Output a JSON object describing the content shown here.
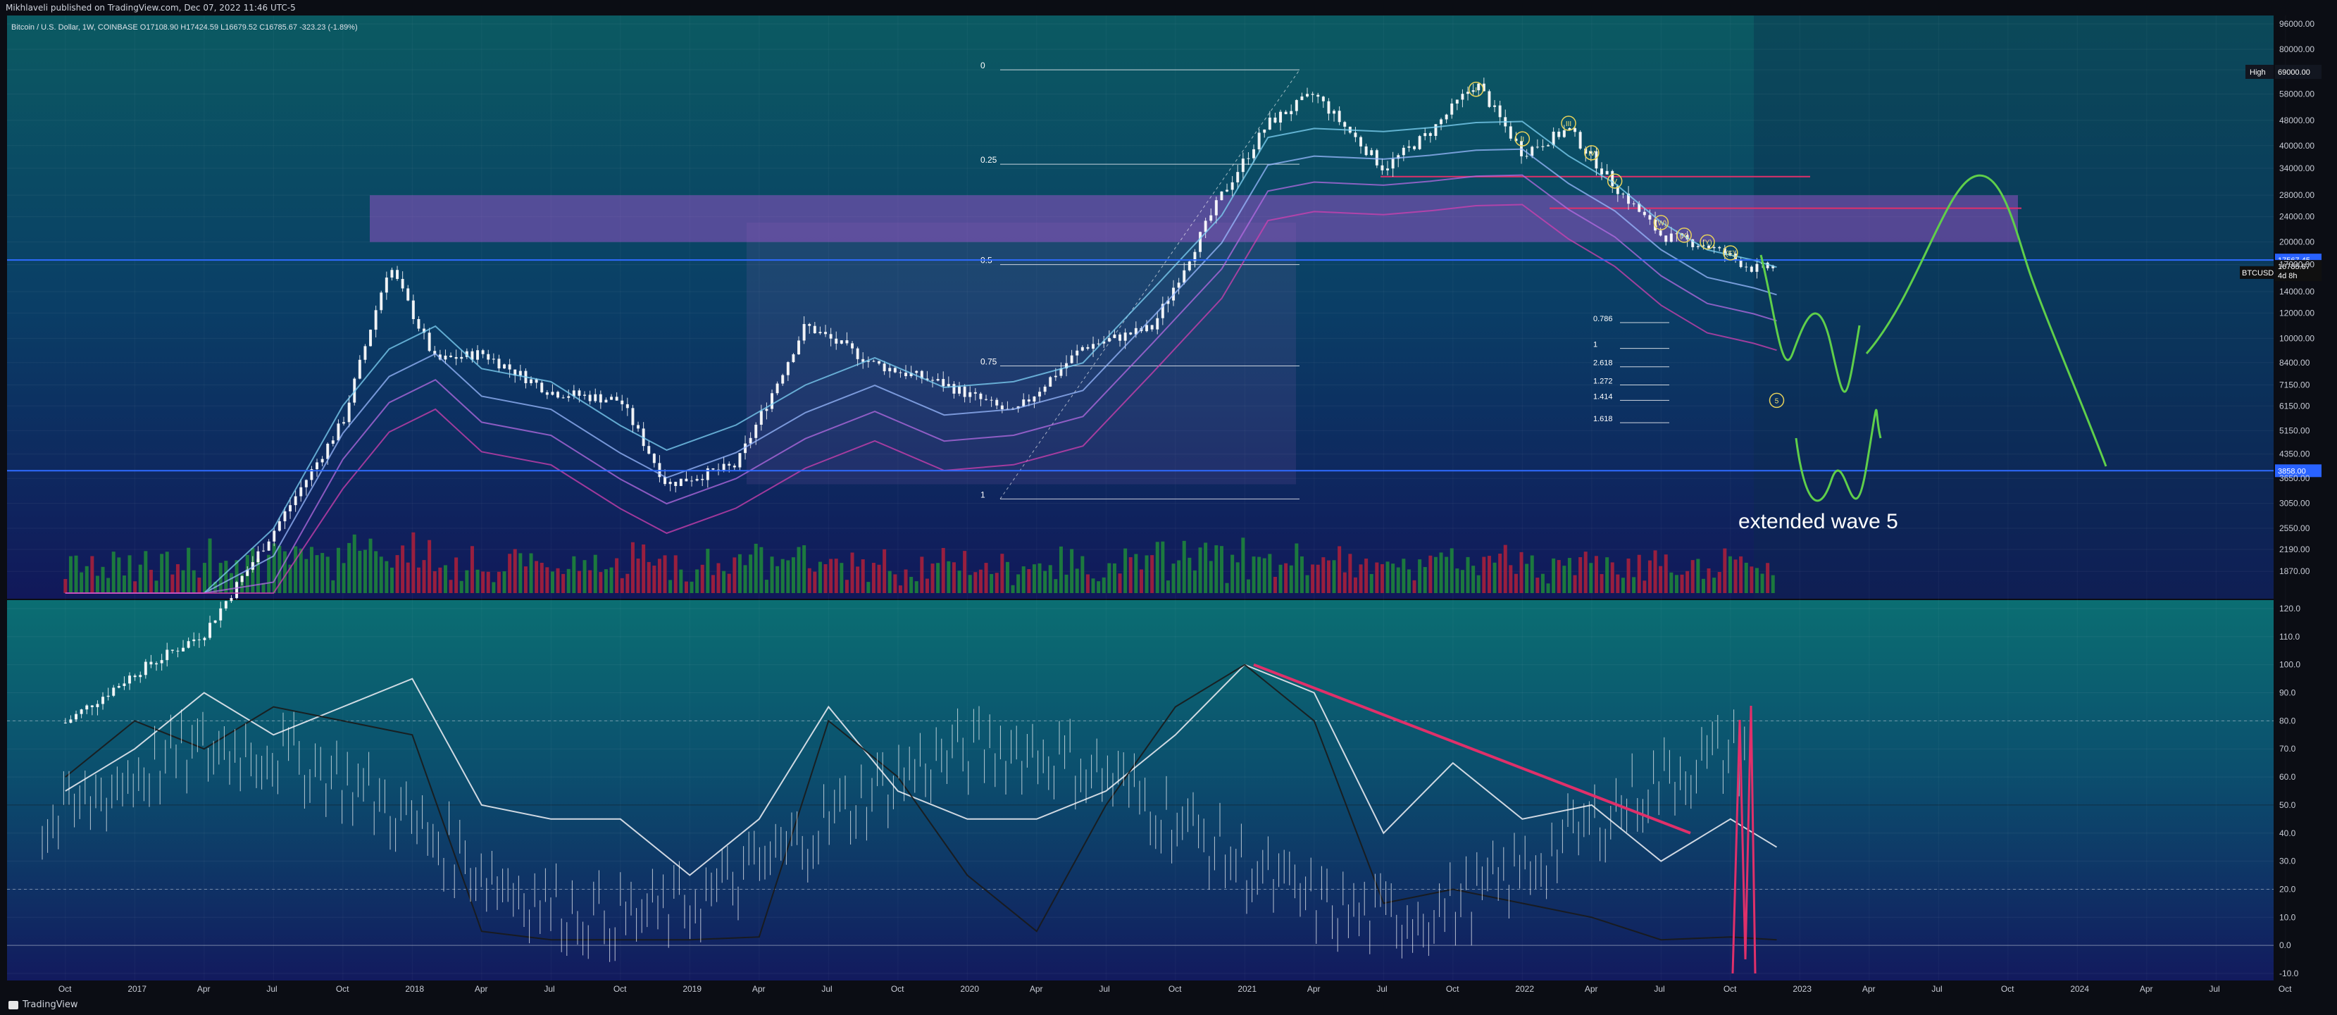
{
  "header": {
    "publisher": "Mikhlaveli published on TradingView.com, Dec 07, 2022 11:46 UTC-5"
  },
  "footer": {
    "brand": "TradingView"
  },
  "chart_data": [
    {
      "type": "candlestick",
      "symbol_line": "Bitcoin / U.S. Dollar, 1W, COINBASE O17108.90 H17424.59 L16679.52 C16785.67 -323.23 (-1.89%)",
      "ticker": "BTCUSD",
      "log_scale": true,
      "grid": true,
      "ylim": [
        1600,
        96000
      ],
      "price_axis_ticks": [
        96000,
        80000,
        69000,
        58000,
        48000,
        40000,
        34000,
        28000,
        24000,
        20000,
        17000,
        14000,
        12000,
        10000,
        8400,
        7150,
        6150,
        5150,
        4350,
        3650,
        3050,
        2550,
        2190,
        1870
      ],
      "price_axis_labels": [
        "96000.00",
        "80000.00",
        "69000.00",
        "58000.00",
        "48000.00",
        "40000.00",
        "34000.00",
        "28000.00",
        "24000.00",
        "20000.00",
        "17000.00",
        "14000.00",
        "12000.00",
        "10000.00",
        "8400.00",
        "7150.00",
        "6150.00",
        "5150.00",
        "4350.00",
        "3650.00",
        "3050.00",
        "2550.00",
        "2190.00",
        "1870.00"
      ],
      "time_axis_labels": [
        "Oct",
        "2017",
        "Apr",
        "Jul",
        "Oct",
        "2018",
        "Apr",
        "Jul",
        "Oct",
        "2019",
        "Apr",
        "Jul",
        "Oct",
        "2020",
        "Apr",
        "Jul",
        "Oct",
        "2021",
        "Apr",
        "Jul",
        "Oct",
        "2022",
        "Apr",
        "Jul",
        "Oct",
        "2023",
        "Apr",
        "Jul",
        "Oct",
        "2024",
        "Apr",
        "Jul",
        "Oct"
      ],
      "high_label": "High",
      "high_value": "69000.00",
      "markers": [
        {
          "price": 17567.45,
          "label": "17567.45",
          "color": "#2962ff"
        },
        {
          "price": 16785.67,
          "label": "16785.67",
          "sub": "4d 8h",
          "color": "#101010"
        },
        {
          "price": 3858.0,
          "label": "3858.00",
          "color": "#2962ff"
        }
      ],
      "close_price": 16785.67,
      "fib_retracement": {
        "levels": [
          "0",
          "0.25",
          "0.5",
          "0.75",
          "1"
        ],
        "prices": [
          69000,
          35000,
          17000,
          8200,
          3150
        ]
      },
      "fib_extension_labels": [
        "0.786",
        "1",
        "2.618",
        "1.272",
        "1.414",
        "1.618"
      ],
      "extension_prices": [
        11200,
        9300,
        8150,
        7150,
        6400,
        5450
      ],
      "wave_labels": [
        "I",
        "II",
        "III",
        "IV",
        "V",
        "(W)",
        "(X)",
        "(Y)",
        "(E)",
        "5"
      ],
      "annotation": "extended wave 5",
      "series": [
        {
          "name": "BTCUSD weekly close",
          "x": [
            "2016-10",
            "2017-01",
            "2017-04",
            "2017-07",
            "2017-10",
            "2017-12",
            "2018-02",
            "2018-04",
            "2018-07",
            "2018-10",
            "2018-12",
            "2019-03",
            "2019-06",
            "2019-09",
            "2019-12",
            "2020-03",
            "2020-06",
            "2020-09",
            "2020-12",
            "2021-02",
            "2021-04",
            "2021-07",
            "2021-09",
            "2021-11",
            "2022-01",
            "2022-03",
            "2022-05",
            "2022-07",
            "2022-09",
            "2022-11",
            "2022-12"
          ],
          "values": [
            630,
            900,
            1200,
            2500,
            5500,
            17000,
            8500,
            9000,
            6800,
            6400,
            3500,
            4000,
            11000,
            8300,
            7200,
            5800,
            9400,
            10800,
            28000,
            47000,
            58000,
            34000,
            44000,
            63000,
            38000,
            45000,
            30000,
            21000,
            19500,
            16500,
            16785.67
          ]
        }
      ]
    },
    {
      "type": "line",
      "name": "Oscillator",
      "ylim": [
        -10,
        120
      ],
      "axis_ticks": [
        120,
        110,
        100,
        90,
        80,
        70,
        60,
        50,
        40,
        30,
        20,
        10,
        0,
        -10
      ],
      "axis_labels": [
        "120.0",
        "110.0",
        "100.0",
        "90.0",
        "80.0",
        "70.0",
        "60.0",
        "50.0",
        "40.0",
        "30.0",
        "20.0",
        "10.0",
        "0.0",
        "-10.0"
      ],
      "levels": [
        80,
        20
      ],
      "series": [
        {
          "name": "",
          "x": [
            "2016-10",
            "2017-01",
            "2017-04",
            "2017-07",
            "2017-10",
            "2018-01",
            "2018-04",
            "2018-07",
            "2018-10",
            "2019-01",
            "2019-04",
            "2019-07",
            "2019-10",
            "2020-01",
            "2020-04",
            "2020-07",
            "2020-10",
            "2021-01",
            "2021-04",
            "2021-07",
            "2021-10",
            "2022-01",
            "2022-04",
            "2022-07",
            "2022-10",
            "2022-12"
          ],
          "values": [
            55,
            70,
            90,
            75,
            85,
            95,
            50,
            45,
            45,
            25,
            45,
            85,
            55,
            45,
            45,
            55,
            75,
            100,
            90,
            40,
            65,
            45,
            50,
            30,
            45,
            35
          ]
        },
        {
          "name": "",
          "x": [
            "2016-10",
            "2017-01",
            "2017-04",
            "2017-07",
            "2017-10",
            "2018-01",
            "2018-04",
            "2018-07",
            "2018-10",
            "2019-01",
            "2019-04",
            "2019-07",
            "2019-10",
            "2020-01",
            "2020-04",
            "2020-07",
            "2020-10",
            "2021-01",
            "2021-04",
            "2021-07",
            "2021-10",
            "2022-01",
            "2022-04",
            "2022-07",
            "2022-10",
            "2022-12"
          ],
          "values": [
            60,
            80,
            70,
            85,
            80,
            75,
            5,
            2,
            2,
            2,
            3,
            80,
            60,
            25,
            5,
            50,
            85,
            100,
            80,
            15,
            20,
            15,
            10,
            2,
            3,
            2
          ]
        }
      ]
    }
  ]
}
